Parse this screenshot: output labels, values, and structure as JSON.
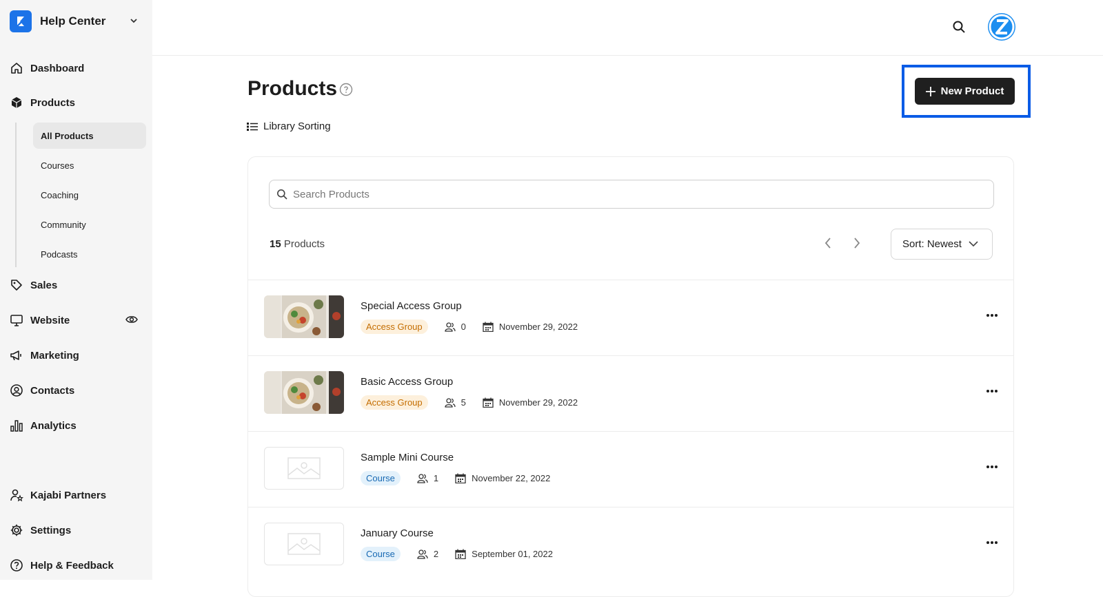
{
  "sidebar": {
    "brand": "Help Center",
    "nav": {
      "dashboard": "Dashboard",
      "products": "Products",
      "sales": "Sales",
      "website": "Website",
      "marketing": "Marketing",
      "contacts": "Contacts",
      "analytics": "Analytics",
      "partners": "Kajabi Partners",
      "settings": "Settings",
      "help": "Help & Feedback"
    },
    "products_sub": {
      "all": "All Products",
      "courses": "Courses",
      "coaching": "Coaching",
      "community": "Community",
      "podcasts": "Podcasts"
    }
  },
  "header": {
    "title": "Products",
    "library_sorting": "Library Sorting",
    "new_product": "New Product"
  },
  "list": {
    "search_placeholder": "Search Products",
    "count_number": "15",
    "count_label": "Products",
    "sort_label": "Sort: Newest",
    "items": [
      {
        "title": "Special Access Group",
        "type": "Access Group",
        "members": "0",
        "date": "November 29, 2022"
      },
      {
        "title": "Basic Access Group",
        "type": "Access Group",
        "members": "5",
        "date": "November 29, 2022"
      },
      {
        "title": "Sample Mini Course",
        "type": "Course",
        "members": "1",
        "date": "November 22, 2022"
      },
      {
        "title": "January Course",
        "type": "Course",
        "members": "2",
        "date": "September 01, 2022"
      }
    ]
  },
  "colors": {
    "accent": "#1c73e8",
    "highlight": "#0a5ce6",
    "access_badge_bg": "#fdf0dc",
    "access_badge_text": "#c46d00",
    "course_badge_bg": "#e3f1fb",
    "course_badge_text": "#1769b3"
  }
}
